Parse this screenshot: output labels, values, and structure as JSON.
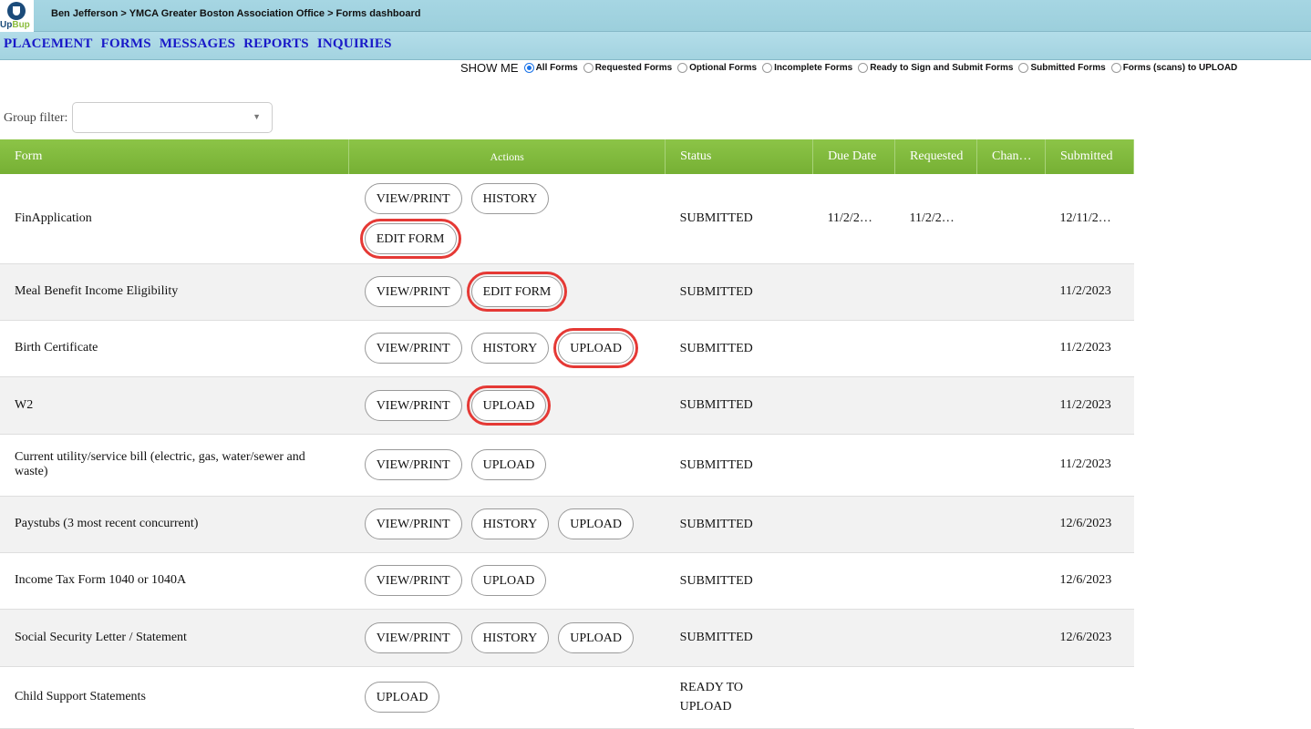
{
  "app": {
    "logo_text_a": "Up",
    "logo_text_b": "Bup"
  },
  "breadcrumb": "Ben Jefferson > YMCA Greater Boston Association Office > Forms dashboard",
  "nav": [
    "PLACEMENT",
    "FORMS",
    "MESSAGES",
    "REPORTS",
    "INQUIRIES"
  ],
  "show_me": {
    "label": "SHOW ME",
    "options": [
      {
        "label": "All Forms",
        "selected": true
      },
      {
        "label": "Requested Forms",
        "selected": false
      },
      {
        "label": "Optional Forms",
        "selected": false
      },
      {
        "label": "Incomplete Forms",
        "selected": false
      },
      {
        "label": "Ready to Sign and Submit Forms",
        "selected": false
      },
      {
        "label": "Submitted Forms",
        "selected": false
      },
      {
        "label": "Forms (scans) to UPLOAD",
        "selected": false
      }
    ]
  },
  "group_filter": {
    "label": "Group filter:",
    "value": ""
  },
  "table": {
    "headers": [
      "Form",
      "Actions",
      "Status",
      "Due Date",
      "Requested",
      "Chan…",
      "Submitted"
    ],
    "rows": [
      {
        "form": "FinApplication",
        "actions": [
          "VIEW/PRINT",
          "HISTORY",
          "EDIT FORM"
        ],
        "highlight": [
          "EDIT FORM"
        ],
        "status": "SUBMITTED",
        "due": "11/2/2…",
        "requested": "11/2/2…",
        "changed": "",
        "submitted": "12/11/2…"
      },
      {
        "form": "Meal Benefit Income Eligibility",
        "actions": [
          "VIEW/PRINT",
          "EDIT FORM"
        ],
        "highlight": [
          "EDIT FORM"
        ],
        "status": "SUBMITTED",
        "due": "",
        "requested": "",
        "changed": "",
        "submitted": "11/2/2023"
      },
      {
        "form": "Birth Certificate",
        "actions": [
          "VIEW/PRINT",
          "HISTORY",
          "UPLOAD"
        ],
        "highlight": [
          "UPLOAD"
        ],
        "status": "SUBMITTED",
        "due": "",
        "requested": "",
        "changed": "",
        "submitted": "11/2/2023"
      },
      {
        "form": "W2",
        "actions": [
          "VIEW/PRINT",
          "UPLOAD"
        ],
        "highlight": [
          "UPLOAD"
        ],
        "status": "SUBMITTED",
        "due": "",
        "requested": "",
        "changed": "",
        "submitted": "11/2/2023"
      },
      {
        "form": "Current utility/service bill (electric, gas, water/sewer and waste)",
        "actions": [
          "VIEW/PRINT",
          "UPLOAD"
        ],
        "highlight": [],
        "status": "SUBMITTED",
        "due": "",
        "requested": "",
        "changed": "",
        "submitted": "11/2/2023"
      },
      {
        "form": "Paystubs (3 most recent concurrent)",
        "actions": [
          "VIEW/PRINT",
          "HISTORY",
          "UPLOAD"
        ],
        "highlight": [],
        "status": "SUBMITTED",
        "due": "",
        "requested": "",
        "changed": "",
        "submitted": "12/6/2023"
      },
      {
        "form": "Income Tax Form 1040 or 1040A",
        "actions": [
          "VIEW/PRINT",
          "UPLOAD"
        ],
        "highlight": [],
        "status": "SUBMITTED",
        "due": "",
        "requested": "",
        "changed": "",
        "submitted": "12/6/2023"
      },
      {
        "form": "Social Security Letter / Statement",
        "actions": [
          "VIEW/PRINT",
          "HISTORY",
          "UPLOAD"
        ],
        "highlight": [],
        "status": "SUBMITTED",
        "due": "",
        "requested": "",
        "changed": "",
        "submitted": "12/6/2023"
      },
      {
        "form": "Child Support Statements",
        "actions": [
          "UPLOAD"
        ],
        "highlight": [],
        "status": "READY TO UPLOAD",
        "due": "",
        "requested": "",
        "changed": "",
        "submitted": ""
      }
    ]
  },
  "colors": {
    "header_green": "#7fb83c",
    "nav_link": "#1919c8",
    "highlight_box": "#e53935",
    "topbar": "#a6d6e3"
  }
}
